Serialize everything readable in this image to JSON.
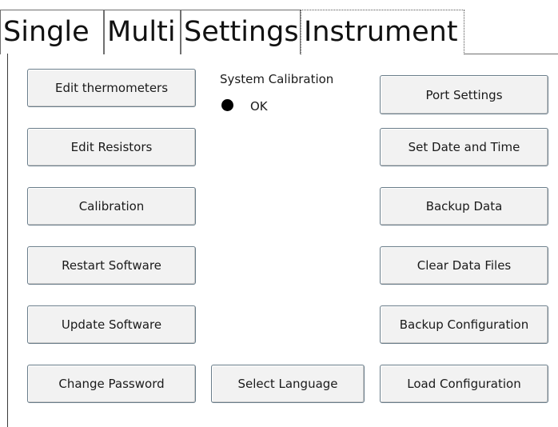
{
  "tabs": [
    {
      "label": "Single"
    },
    {
      "label": "Multi"
    },
    {
      "label": "Settings"
    },
    {
      "label": "Instrument",
      "selected": true
    }
  ],
  "left_buttons": [
    {
      "label": "Edit thermometers"
    },
    {
      "label": "Edit Resistors"
    },
    {
      "label": "Calibration"
    },
    {
      "label": "Restart Software"
    },
    {
      "label": "Update Software"
    },
    {
      "label": "Change Password"
    }
  ],
  "middle": {
    "status_label": "System Calibration",
    "status_indicator_color": "#000000",
    "status_value": "OK",
    "select_language_label": "Select Language"
  },
  "right_buttons": [
    {
      "label": "Port Settings"
    },
    {
      "label": "Set Date and Time"
    },
    {
      "label": "Backup Data"
    },
    {
      "label": "Clear Data Files"
    },
    {
      "label": "Backup Configuration"
    },
    {
      "label": "Load Configuration"
    }
  ]
}
